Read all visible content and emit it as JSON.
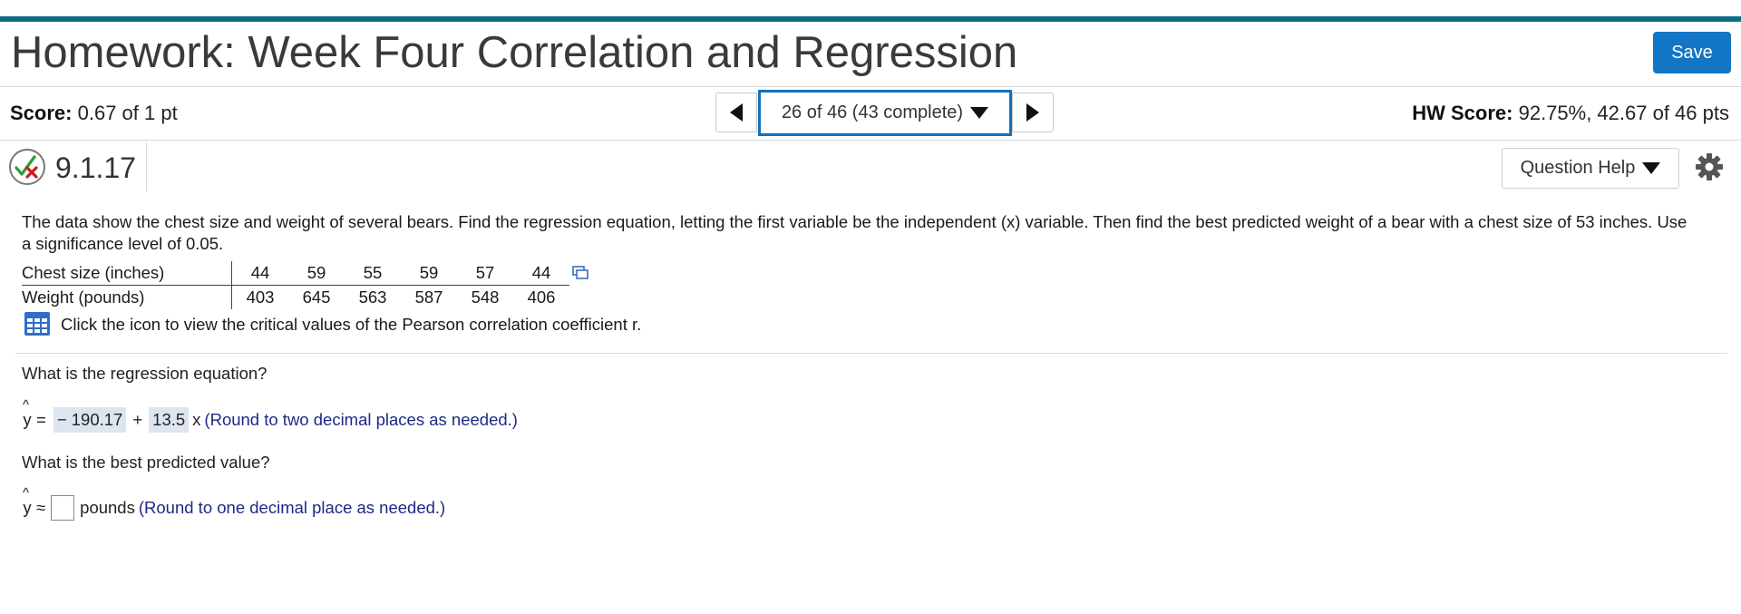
{
  "header": {
    "title": "Homework: Week Four Correlation and Regression",
    "save_label": "Save"
  },
  "score_bar": {
    "score_label": "Score:",
    "score_value": "0.67 of 1 pt",
    "nav_position": "26 of 46 (43 complete)",
    "hw_score_label": "HW Score:",
    "hw_score_value": "92.75%, 42.67 of 46 pts"
  },
  "question_bar": {
    "status_icon": "partial-credit-icon",
    "number": "9.1.17",
    "help_label": "Question Help",
    "settings_icon": "gear-icon"
  },
  "problem": {
    "prompt": "The data show the chest size and weight of several bears. Find the regression equation, letting the first variable be the independent (x) variable. Then find the best predicted weight of a bear with a chest size of 53 inches. Use a significance level of 0.05.",
    "table": {
      "rows": [
        {
          "label": "Chest size (inches)",
          "values": [
            "44",
            "59",
            "55",
            "59",
            "57",
            "44"
          ]
        },
        {
          "label": "Weight (pounds)",
          "values": [
            "403",
            "645",
            "563",
            "587",
            "548",
            "406"
          ]
        }
      ]
    },
    "critical_values_text": "Click the icon to view the critical values of the Pearson correlation coefficient r."
  },
  "part1": {
    "question": "What is the regression equation?",
    "y_symbol": "y",
    "equals": "=",
    "intercept": "− 190.17",
    "plus": "+",
    "slope": "13.5",
    "x_symbol": "x",
    "hint": "(Round to two decimal places as needed.)"
  },
  "part2": {
    "question": "What is the best predicted value?",
    "y_symbol": "y",
    "approx": "≈",
    "answer": "",
    "unit": "pounds",
    "hint": "(Round to one decimal place as needed.)"
  },
  "colors": {
    "accent_bar": "#0e6e86",
    "save_button": "#1376c5",
    "nav_select_border": "#1370b9",
    "answer_highlight": "#dde5f0",
    "hint_text": "#1c2a87"
  }
}
